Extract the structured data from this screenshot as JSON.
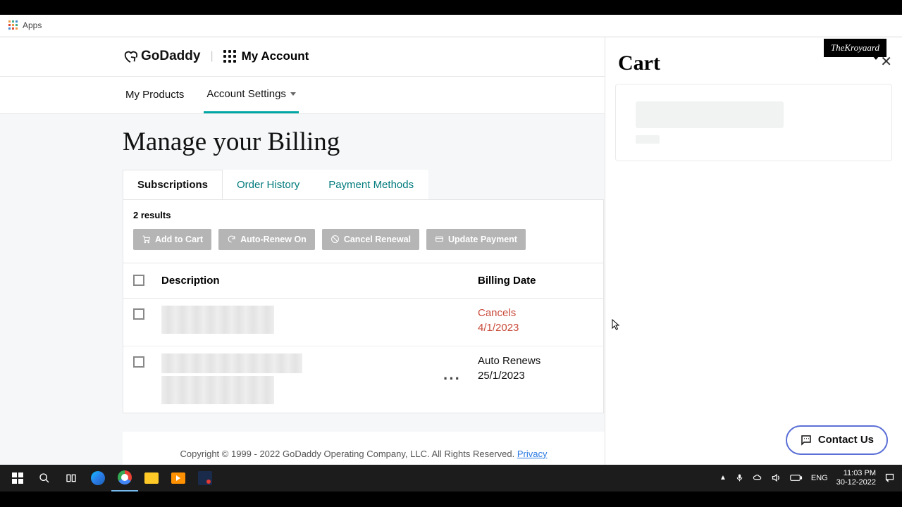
{
  "bookmarks": {
    "apps_label": "Apps"
  },
  "header": {
    "brand": "GoDaddy",
    "account": "My Account"
  },
  "top_tabs": {
    "products": "My Products",
    "settings": "Account Settings"
  },
  "page": {
    "title": "Manage your Billing",
    "tabs": {
      "subscriptions": "Subscriptions",
      "order_history": "Order History",
      "payment_methods": "Payment Methods"
    },
    "results_count": "2 results",
    "actions": {
      "add_cart": "Add to Cart",
      "auto_renew": "Auto-Renew On",
      "cancel_renewal": "Cancel Renewal",
      "update_payment": "Update Payment"
    },
    "columns": {
      "description": "Description",
      "billing_date": "Billing Date"
    },
    "rows": [
      {
        "billing_status": "Cancels",
        "billing_date": "4/1/2023",
        "status_class": "cancel-txt"
      },
      {
        "billing_status": "Auto Renews",
        "billing_date": "25/1/2023",
        "status_class": "renew-txt"
      }
    ]
  },
  "footer": {
    "copyright": "Copyright © 1999 - 2022 GoDaddy Operating Company, LLC. All Rights Reserved. ",
    "privacy": "Privacy"
  },
  "cart": {
    "title": "Cart",
    "brand_badge": "TheKroyaard",
    "contact": "Contact Us"
  },
  "taskbar": {
    "lang": "ENG",
    "time": "11:03 PM",
    "date": "30-12-2022"
  }
}
